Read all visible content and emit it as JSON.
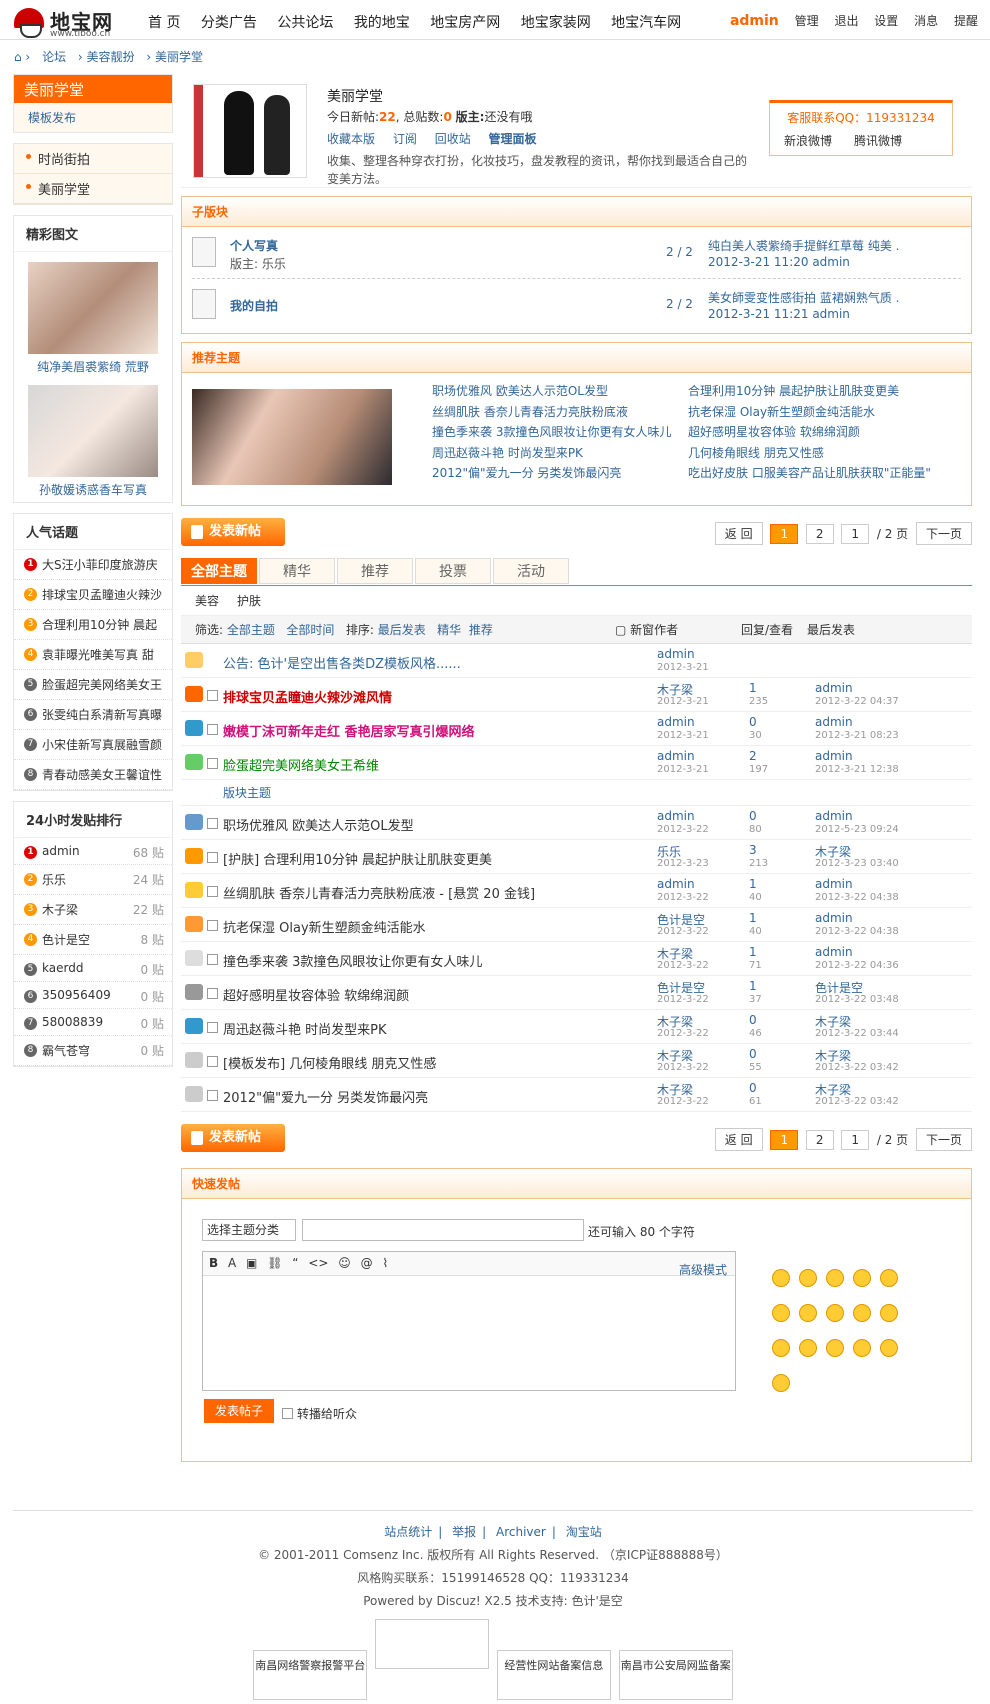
{
  "header": {
    "logo_text": "地宝网",
    "logo_sub": "www.tiboo.cn",
    "nav": [
      "首 页",
      "分类广告",
      "公共论坛",
      "我的地宝",
      "地宝房产网",
      "地宝家装网",
      "地宝汽车网"
    ],
    "user": "admin",
    "admin_links": [
      "管理",
      "退出",
      "设置",
      "消息",
      "提醒"
    ]
  },
  "breadcrumb": [
    "论坛",
    "美容靓扮",
    "美丽学堂"
  ],
  "left": {
    "forum_title": "美丽学堂",
    "forum_sub": "模板发布",
    "menu": [
      "时尚街拍",
      "美丽学堂"
    ],
    "gallery_title": "精彩图文",
    "gallery": [
      "纯净美眉裘紫绮 荒野",
      "孙敬媛诱惑香车写真"
    ],
    "hot_title": "人气话题",
    "hot": [
      "大S汪小菲印度旅游庆",
      "排球宝贝孟瞳迪火辣沙",
      "合理利用10分钟 晨起",
      "袁菲曝光唯美写真 甜",
      "脸蛋超完美网络美女王",
      "张雯纯白系清新写真曝",
      "小宋佳新写真展融雪颜",
      "青春动感美女王馨谊性"
    ],
    "rank_title": "24小时发贴排行",
    "rank": [
      {
        "n": "1",
        "name": "admin",
        "cnt": "68 贴"
      },
      {
        "n": "2",
        "name": "乐乐",
        "cnt": "24 贴"
      },
      {
        "n": "3",
        "name": "木子梁",
        "cnt": "22 贴"
      },
      {
        "n": "4",
        "name": "色计是空",
        "cnt": "8 贴"
      },
      {
        "n": "5",
        "name": "kaerdd",
        "cnt": "0 贴"
      },
      {
        "n": "6",
        "name": "350956409",
        "cnt": "0 贴"
      },
      {
        "n": "7",
        "name": "58008839",
        "cnt": "0 贴"
      },
      {
        "n": "8",
        "name": "霸气苍穹",
        "cnt": "0 贴"
      }
    ]
  },
  "forum": {
    "name": "美丽学堂",
    "today_label": "今日新帖:",
    "today": "22",
    "total_label": ", 总贴数:",
    "total": "0",
    "mod_label": "版主:",
    "mod": "还没有哦",
    "actions": [
      "收藏本版",
      "订阅",
      "回收站",
      "管理面板"
    ],
    "desc": "收集、整理各种穿衣打扮，化妆技巧，盘发教程的资讯，帮你找到最适合自己的变美方法。",
    "qq": "客服联系QQ：119331234",
    "weibo": [
      "新浪微博",
      "腾讯微博"
    ]
  },
  "subforums": {
    "title": "子版块",
    "items": [
      {
        "name": "个人写真",
        "mod": "版主: 乐乐",
        "count": "2 / 2",
        "last": "纯白美人裘紫绮手提鲜红草莓 纯美 ...",
        "lastd": "2012-3-21 11:20 admin"
      },
      {
        "name": "我的自拍",
        "mod": "",
        "count": "2 / 2",
        "last": "美女師雯变性感街拍 蓝裙娴熟气质 ...",
        "lastd": "2012-3-21 11:21 admin"
      }
    ]
  },
  "recommend": {
    "title": "推荐主题",
    "col1": [
      "职场优雅风 欧美达人示范OL发型",
      "丝绸肌肤 香奈儿青春活力亮肤粉底液",
      "撞色季来袭 3款撞色风眼妆让你更有女人味儿",
      "周迅赵薇斗艳 时尚发型来PK",
      "2012\"偏\"爱九一分 另类发饰最闪亮"
    ],
    "col2": [
      "合理利用10分钟 晨起护肤让肌肤变更美",
      "抗老保湿 Olay新生塑颜金纯活能水",
      "超好感明星妆容体验 软绵绵润颜",
      "几何棱角眼线 朋克又性感",
      "吃出好皮肤 口服美容产品让肌肤获取\"正能量\""
    ]
  },
  "toolbar": {
    "post": "发表新帖",
    "pager": [
      "返 回",
      "1",
      "2",
      "1",
      "/ 2 页",
      "下一页"
    ]
  },
  "tabs": [
    "全部主题",
    "精华",
    "推荐",
    "投票",
    "活动"
  ],
  "cats": [
    "美容",
    "护肤"
  ],
  "filter": {
    "text": "筛选:",
    "all": "全部主题",
    "time": "全部时间",
    "sort": "排序:",
    "latest": "最后发表",
    "digest": "精华",
    "rec": "推荐",
    "newwin": "新窗作者",
    "reply": "回复/查看",
    "last": "最后发表"
  },
  "threads": [
    {
      "title": "公告: 色计'是空出售各类DZ模板风格......",
      "cls": "blueb",
      "au": "admin",
      "ad": "2012-3-21",
      "rp": "",
      "vw": "",
      "la": "",
      "ld": "",
      "ic": "#fc6"
    },
    {
      "title": "排球宝贝孟瞳迪火辣沙滩风情",
      "cls": "red",
      "au": "木子梁",
      "ad": "2012-3-21",
      "rp": "1",
      "vw": "235",
      "la": "admin",
      "ld": "2012-3-22 04:37",
      "ic": "#f60"
    },
    {
      "title": "嫩模丁沫可新年走红 香艳居家写真引爆网络",
      "cls": "pink",
      "au": "admin",
      "ad": "2012-3-21",
      "rp": "0",
      "vw": "30",
      "la": "admin",
      "ld": "2012-3-21 08:23",
      "ic": "#39c"
    },
    {
      "title": "脸蛋超完美网络美女王希维",
      "cls": "green",
      "au": "admin",
      "ad": "2012-3-21",
      "rp": "2",
      "vw": "197",
      "la": "admin",
      "ld": "2012-3-21 12:38",
      "ic": "#6c6"
    },
    {
      "title": "职场优雅风 欧美达人示范OL发型",
      "cls": "",
      "au": "admin",
      "ad": "2012-3-22",
      "rp": "0",
      "vw": "80",
      "la": "admin",
      "ld": "2012-5-23 09:24",
      "ic": "#69c"
    },
    {
      "title": "[护肤] 合理利用10分钟 晨起护肤让肌肤变更美",
      "cls": "",
      "au": "乐乐",
      "ad": "2012-3-23",
      "rp": "3",
      "vw": "213",
      "la": "木子梁",
      "ld": "2012-3-23 03:40",
      "ic": "#f90"
    },
    {
      "title": "丝绸肌肤 香奈儿青春活力亮肤粉底液 - [悬赏 20 金钱]",
      "cls": "",
      "au": "admin",
      "ad": "2012-3-22",
      "rp": "1",
      "vw": "40",
      "la": "admin",
      "ld": "2012-3-22 04:38",
      "ic": "#fc3"
    },
    {
      "title": "抗老保湿 Olay新生塑颜金纯活能水",
      "cls": "",
      "au": "色计是空",
      "ad": "2012-3-22",
      "rp": "1",
      "vw": "40",
      "la": "admin",
      "ld": "2012-3-22 04:38",
      "ic": "#f93"
    },
    {
      "title": "撞色季来袭 3款撞色风眼妆让你更有女人味儿",
      "cls": "",
      "au": "木子梁",
      "ad": "2012-3-22",
      "rp": "1",
      "vw": "71",
      "la": "admin",
      "ld": "2012-3-22 04:36",
      "ic": "#ddd"
    },
    {
      "title": "超好感明星妆容体验 软绵绵润颜",
      "cls": "",
      "au": "色计是空",
      "ad": "2012-3-22",
      "rp": "1",
      "vw": "37",
      "la": "色计是空",
      "ld": "2012-3-22 03:48",
      "ic": "#999"
    },
    {
      "title": "周迅赵薇斗艳 时尚发型来PK",
      "cls": "",
      "au": "木子梁",
      "ad": "2012-3-22",
      "rp": "0",
      "vw": "46",
      "la": "木子梁",
      "ld": "2012-3-22 03:44",
      "ic": "#39c"
    },
    {
      "title": "[模板发布] 几何棱角眼线 朋克又性感",
      "cls": "",
      "au": "木子梁",
      "ad": "2012-3-22",
      "rp": "0",
      "vw": "55",
      "la": "木子梁",
      "ld": "2012-3-22 03:42",
      "ic": "#ccc"
    },
    {
      "title": "2012\"偏\"爱九一分 另类发饰最闪亮",
      "cls": "",
      "au": "木子梁",
      "ad": "2012-3-22",
      "rp": "0",
      "vw": "61",
      "la": "木子梁",
      "ld": "2012-3-22 03:42",
      "ic": "#ccc"
    }
  ],
  "section_label": "版块主题",
  "quick": {
    "title": "快速发帖",
    "select": "选择主题分类",
    "limit": "还可输入 80 个字符",
    "adv": "高级模式",
    "submit": "发表帖子",
    "relay": "转播给听众"
  },
  "footer": {
    "links": [
      "站点统计",
      "举报",
      "Archiver",
      "淘宝站"
    ],
    "copy": "© 2001-2011 Comsenz Inc. 版权所有 All Rights Reserved. （京ICP证888888号）",
    "contact": "风格购买联系：15199146528 QQ：119331234",
    "powered": "Powered by Discuz! X2.5  技术支持: 色计'是空",
    "badges": [
      "南昌网络警察报警平台",
      "",
      "经营性网站备案信息",
      "南昌市公安局网监备案"
    ]
  }
}
